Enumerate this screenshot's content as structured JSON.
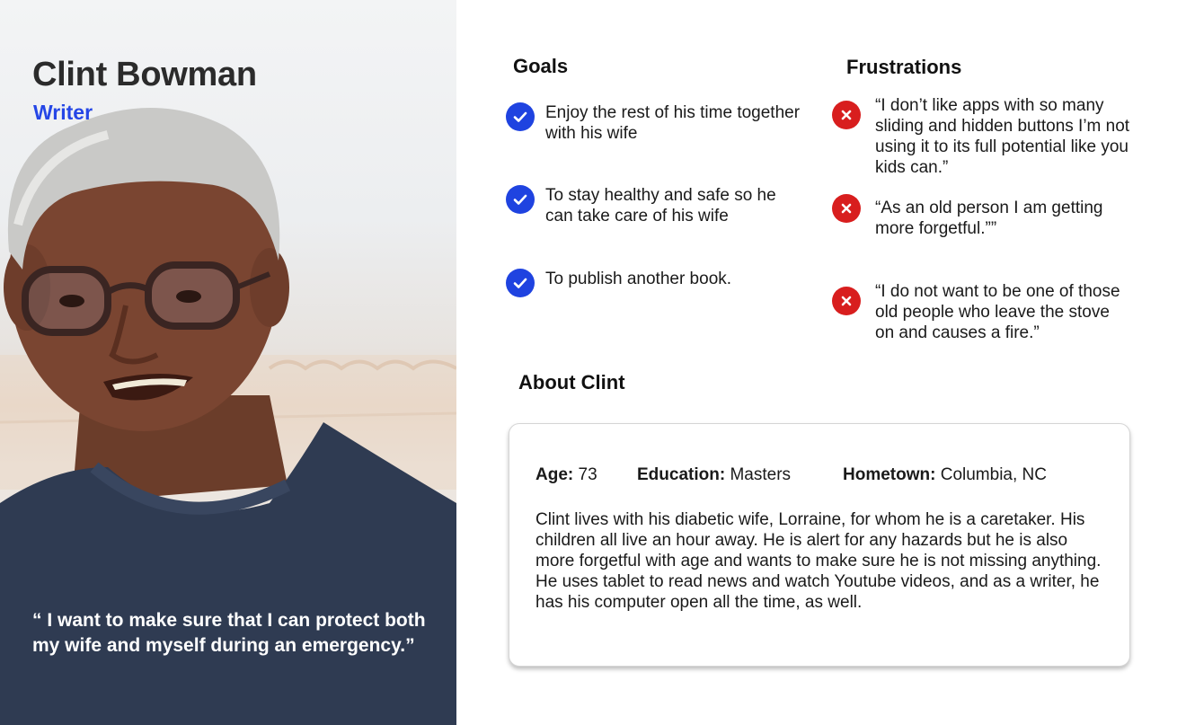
{
  "persona": {
    "name": "Clint Bowman",
    "role": "Writer",
    "quote": "“ I want to make sure that I can protect both my wife and myself during an emergency.”"
  },
  "goals": {
    "title": "Goals",
    "items": [
      {
        "text": "Enjoy the rest of his time together with his wife",
        "icon": "check-circle-icon"
      },
      {
        "text": "To stay healthy and safe so he can take care of his wife",
        "icon": "check-circle-icon"
      },
      {
        "text": "To publish another book.",
        "icon": "check-circle-icon"
      }
    ]
  },
  "frustrations": {
    "title": "Frustrations",
    "items": [
      {
        "text": "“I don’t like apps with so many sliding and hidden buttons I’m not using it to its full potential like you kids can.”",
        "icon": "x-circle-icon"
      },
      {
        "text": "“As an old person I am getting more forgetful.””",
        "icon": "x-circle-icon"
      },
      {
        "text": "“I do not want to be one of those old people who leave the stove on and causes a fire.”",
        "icon": "x-circle-icon"
      }
    ]
  },
  "about": {
    "title": "About Clint",
    "age_label": "Age:",
    "age_value": "73",
    "education_label": "Education:",
    "education_value": "Masters",
    "hometown_label": "Hometown:",
    "hometown_value": "Columbia, NC",
    "description": "Clint lives with his diabetic wife, Lorraine, for whom he is a caretaker. His children all live an hour away. He is alert for any hazards but he is also more forgetful with age and wants to make sure he is not missing anything. He uses tablet to read news and watch Youtube videos, and as a writer, he has his computer open all the time, as well."
  },
  "colors": {
    "accent_blue": "#2546e6",
    "goal_icon": "#1f43e0",
    "frustration_icon": "#d81e1e",
    "sweater": "#2f3b52"
  }
}
